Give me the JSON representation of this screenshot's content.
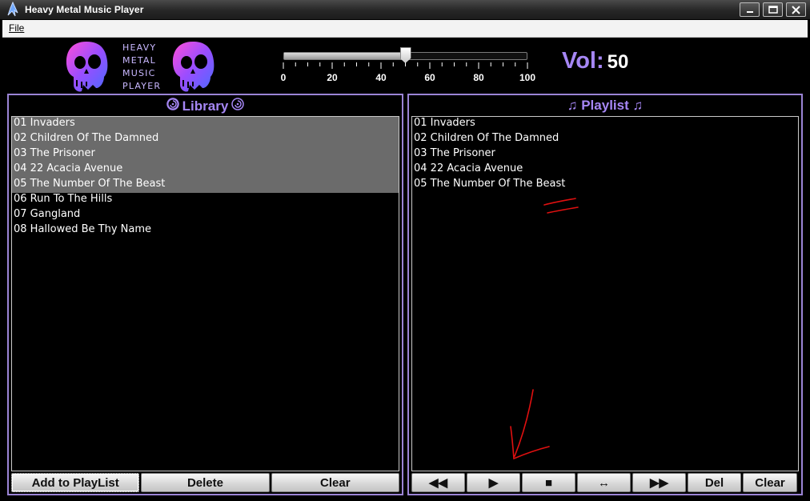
{
  "window": {
    "title": "Heavy Metal Music Player"
  },
  "menu": {
    "items": [
      {
        "label": "File"
      }
    ]
  },
  "logo": {
    "lines": [
      "HEAVY",
      "METAL",
      "MUSIC",
      "PLAYER"
    ]
  },
  "volume": {
    "label": "Vol:",
    "value": "50",
    "slider_value": 50,
    "scale_labels": [
      "0",
      "20",
      "40",
      "60",
      "80",
      "100"
    ]
  },
  "library": {
    "title": "Library",
    "tracks": [
      {
        "name": "01 Invaders",
        "selected": true
      },
      {
        "name": "02 Children Of The Damned",
        "selected": true
      },
      {
        "name": "03 The Prisoner",
        "selected": true
      },
      {
        "name": "04 22 Acacia Avenue",
        "selected": true
      },
      {
        "name": "05 The Number Of The Beast",
        "selected": true
      },
      {
        "name": "06 Run To The Hills",
        "selected": false
      },
      {
        "name": "07 Gangland",
        "selected": false
      },
      {
        "name": "08 Hallowed Be Thy Name",
        "selected": false
      }
    ],
    "buttons": {
      "add": "Add to PlayList",
      "delete": "Delete",
      "clear": "Clear"
    }
  },
  "playlist": {
    "title": "♫ Playlist ♫",
    "tracks": [
      "01 Invaders",
      "02 Children Of The Damned",
      "03 The Prisoner",
      "04 22 Acacia Avenue",
      "05 The Number Of The Beast"
    ],
    "buttons": {
      "prev": "◀◀",
      "play": "▶",
      "stop": "■",
      "shuffle": "↔",
      "next": "▶▶",
      "del": "Del",
      "clear": "Clear"
    }
  },
  "colors": {
    "accent": "#a687f5",
    "panel_border": "#9b84d6",
    "selection": "#6b6b6b",
    "annotation": "#e01010"
  }
}
